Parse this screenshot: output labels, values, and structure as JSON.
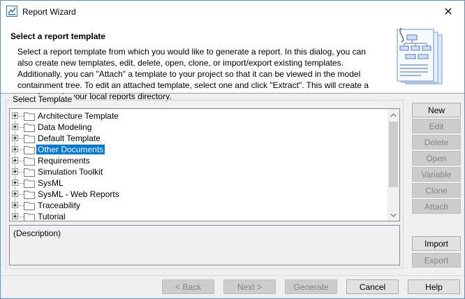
{
  "window": {
    "title": "Report Wizard",
    "close_glyph": "✕"
  },
  "header": {
    "title": "Select a report template",
    "description": "Select a report template from which you would like to generate a report. In this dialog, you can also create new templates, edit, delete, open, clone, or import/export existing templates. Additionally, you can \"Attach\" a template to your project so that it can be viewed in the model containment tree. To edit an attached template, select one and click \"Extract\". This will create a saved copy in your local reports directory."
  },
  "template_group": {
    "label": "Select Template",
    "items": [
      {
        "label": "Architecture Template",
        "selected": false
      },
      {
        "label": "Data Modeling",
        "selected": false
      },
      {
        "label": "Default Template",
        "selected": false
      },
      {
        "label": "Other Documents",
        "selected": true
      },
      {
        "label": "Requirements",
        "selected": false
      },
      {
        "label": "Simulation Toolkit",
        "selected": false
      },
      {
        "label": "SysML",
        "selected": false
      },
      {
        "label": "SysML - Web Reports",
        "selected": false
      },
      {
        "label": "Traceability",
        "selected": false
      },
      {
        "label": "Tutorial",
        "selected": false
      }
    ],
    "description": "(Description)"
  },
  "side_buttons": {
    "new": "New",
    "edit": "Edit",
    "delete": "Delete",
    "open": "Open",
    "variable": "Variable",
    "clone": "Clone",
    "attach": "Attach",
    "import": "Import",
    "export": "Export"
  },
  "bottom_buttons": {
    "back": "< Back",
    "next": "Next >",
    "generate": "Generate",
    "cancel": "Cancel",
    "help": "Help"
  },
  "colors": {
    "selection": "#0078d7",
    "folder": "#e8c36a"
  }
}
